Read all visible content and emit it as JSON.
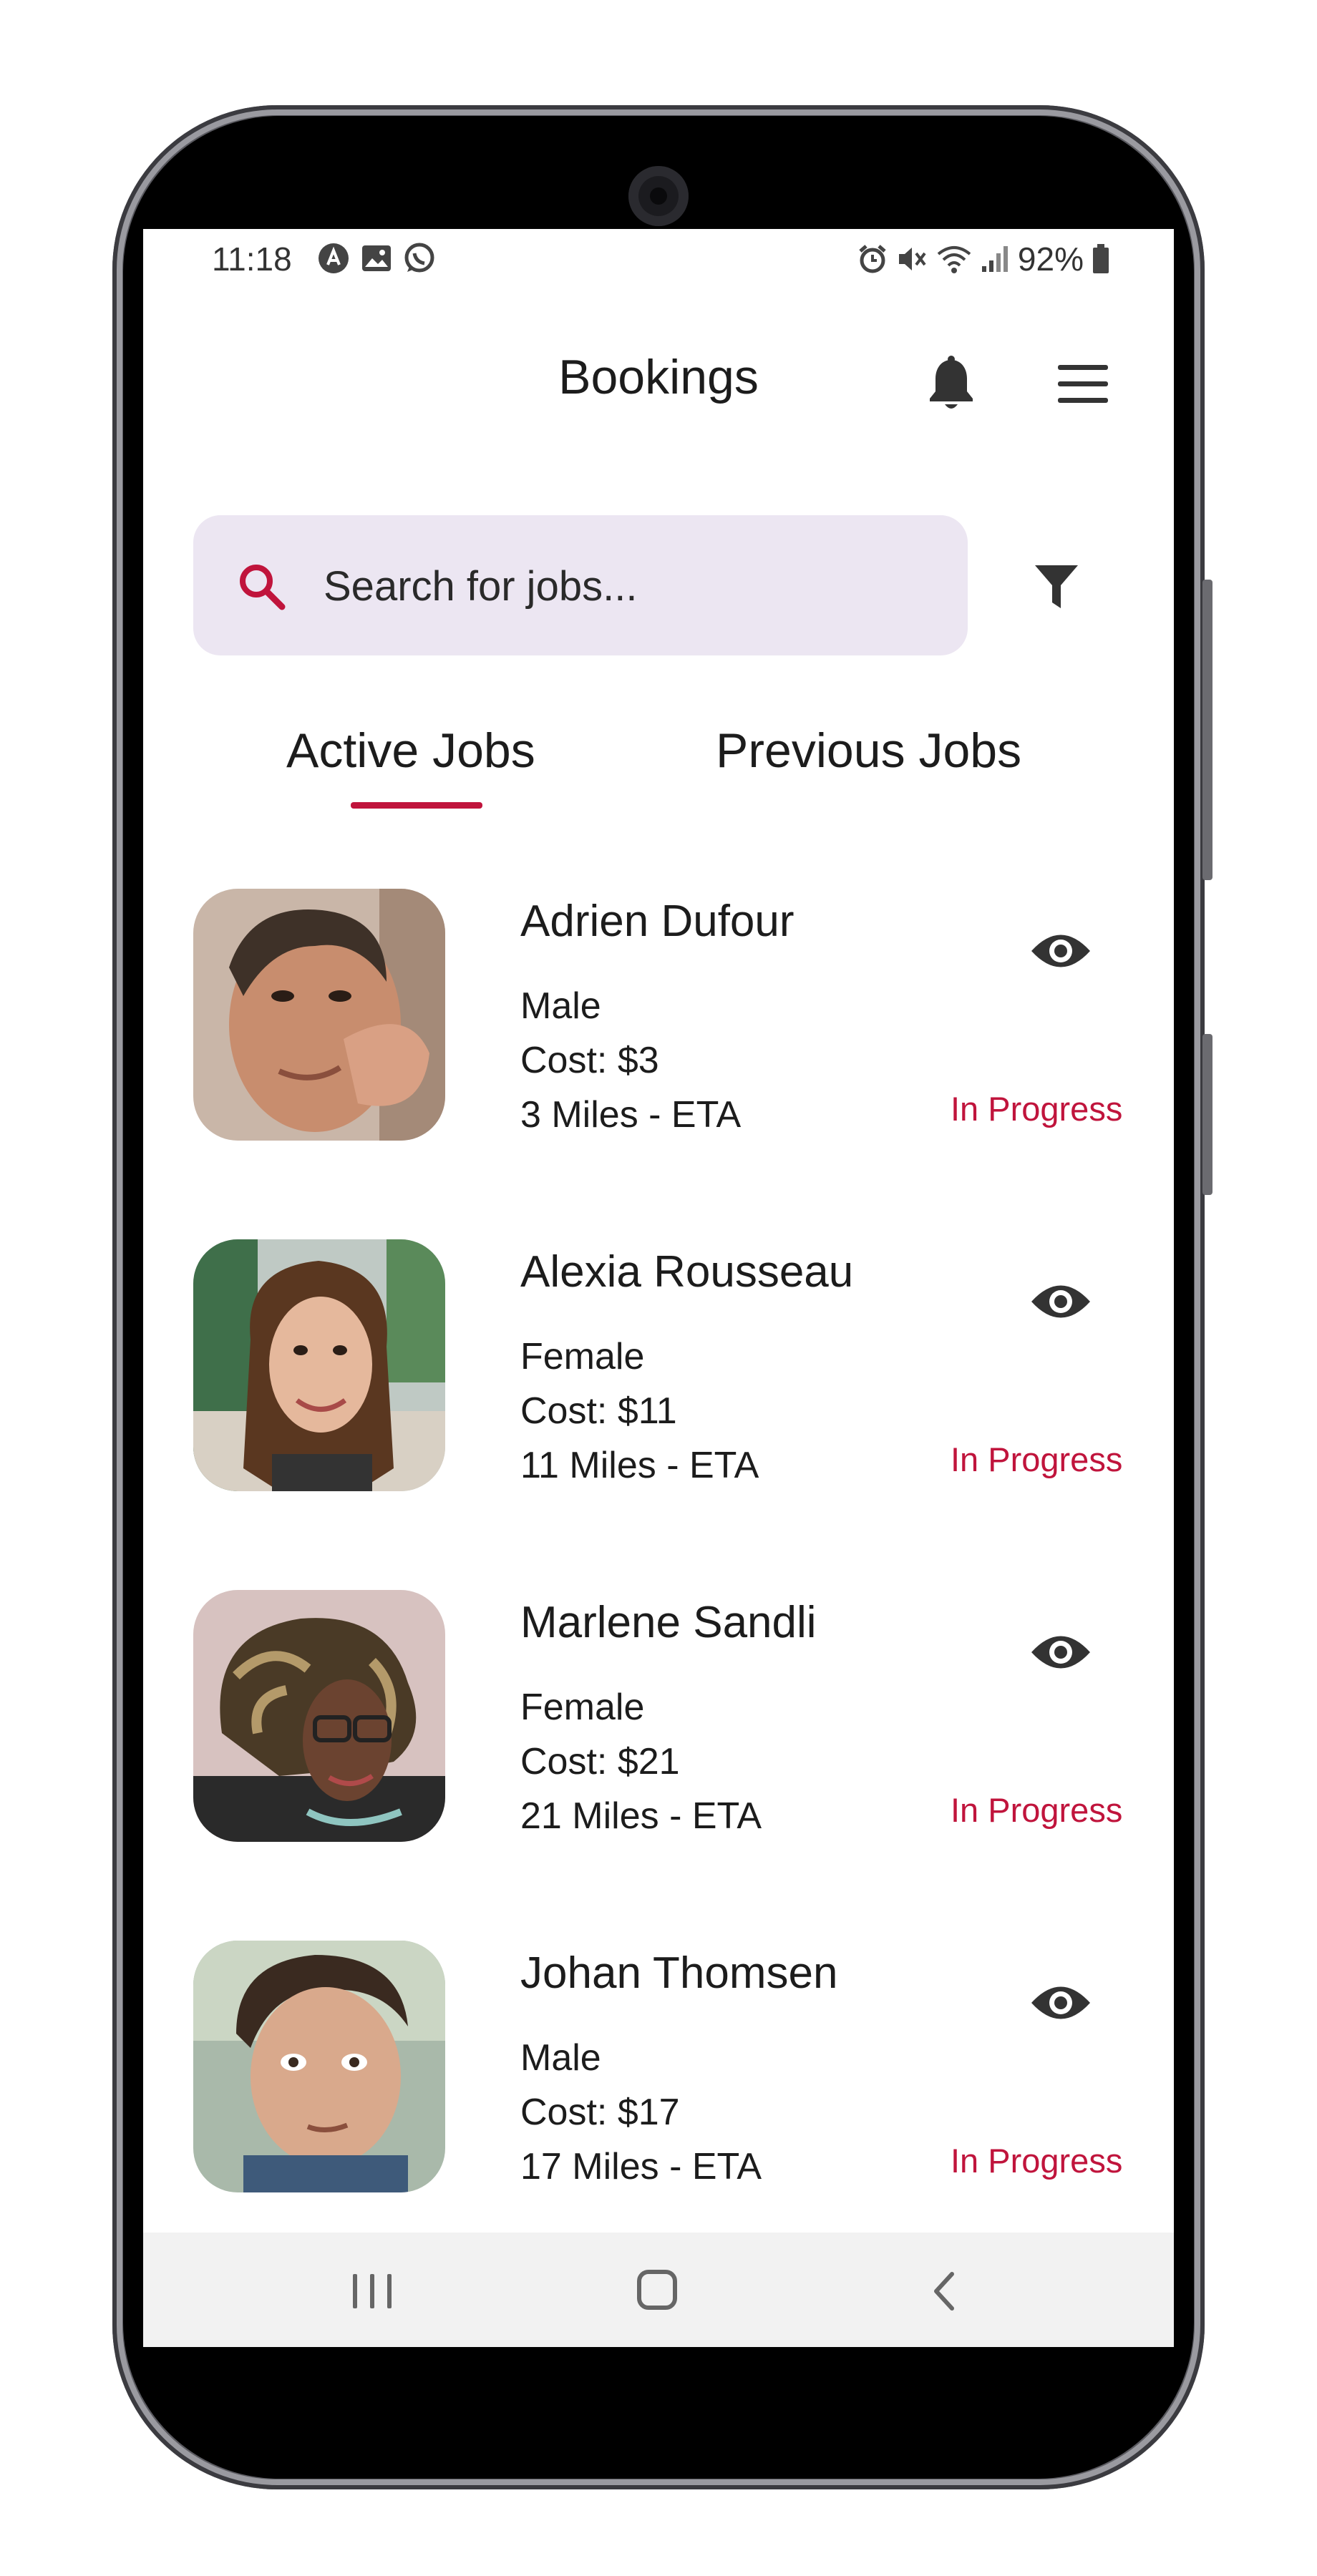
{
  "status_bar": {
    "time": "11:18",
    "battery": "92%",
    "left_icons": [
      "app-notification-icon",
      "image-icon",
      "whatsapp-icon"
    ],
    "right_icons": [
      "alarm-icon",
      "mute-icon",
      "wifi-icon",
      "signal-icon",
      "battery-icon"
    ]
  },
  "header": {
    "title": "Bookings",
    "icons": [
      "bell-icon",
      "hamburger-menu-icon"
    ]
  },
  "search": {
    "placeholder": "Search for jobs...",
    "value": ""
  },
  "tabs": [
    {
      "label": "Active Jobs",
      "active": true
    },
    {
      "label": "Previous Jobs",
      "active": false
    }
  ],
  "jobs": [
    {
      "name": "Adrien Dufour",
      "gender": "Male",
      "cost": "Cost: $3",
      "eta": "3 Miles - ETA",
      "status": "In Progress"
    },
    {
      "name": "Alexia Rousseau",
      "gender": "Female",
      "cost": "Cost: $11",
      "eta": "11 Miles - ETA",
      "status": "In Progress"
    },
    {
      "name": "Marlene Sandli",
      "gender": "Female",
      "cost": "Cost: $21",
      "eta": "21 Miles - ETA",
      "status": "In Progress"
    },
    {
      "name": "Johan Thomsen",
      "gender": "Male",
      "cost": "Cost: $17",
      "eta": "17 Miles - ETA",
      "status": "In Progress"
    }
  ],
  "colors": {
    "accent": "#c0143c",
    "search_background": "#ece6f2",
    "text": "#1c1c1c",
    "nav_background": "#f2f2f2"
  },
  "nav_bar": {
    "icons": [
      "recent-apps-icon",
      "home-icon",
      "back-icon"
    ]
  }
}
